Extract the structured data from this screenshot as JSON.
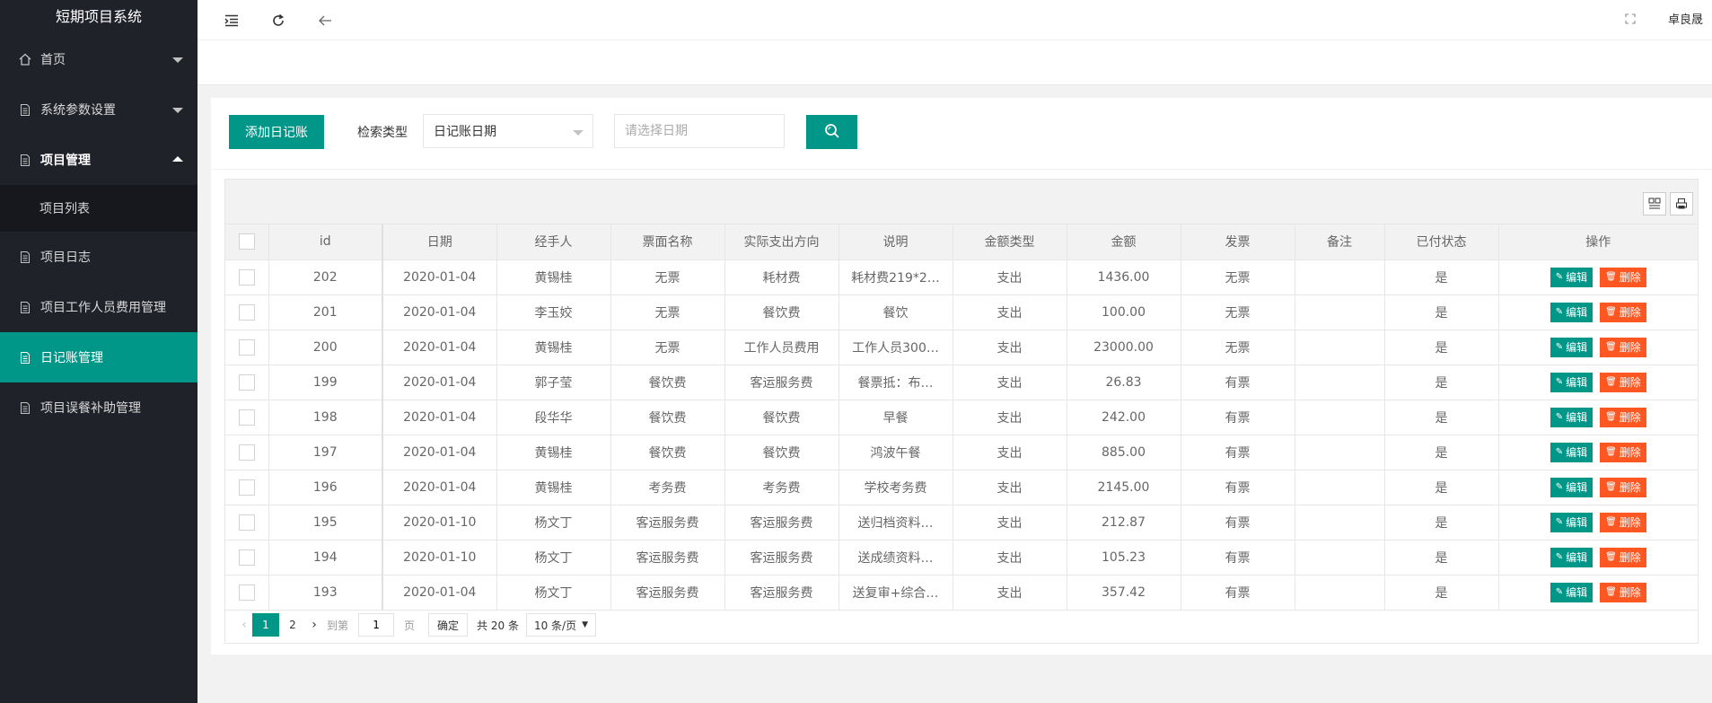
{
  "app": {
    "title": "短期项目系统",
    "user": "卓良晟"
  },
  "sidebar": {
    "items": [
      {
        "label": "首页",
        "icon": "home-icon"
      },
      {
        "label": "系统参数设置",
        "icon": "doc-icon"
      },
      {
        "label": "项目管理",
        "icon": "doc-icon",
        "sub": "项目列表"
      },
      {
        "label": "项目日志",
        "icon": "doc-icon"
      },
      {
        "label": "项目工作人员费用管理",
        "icon": "doc-icon"
      },
      {
        "label": "日记账管理",
        "icon": "doc-icon"
      },
      {
        "label": "项目误餐补助管理",
        "icon": "doc-icon"
      }
    ]
  },
  "toolbar": {
    "add_label": "添加日记账",
    "search_type_label": "检索类型",
    "search_type_value": "日记账日期",
    "date_placeholder": "请选择日期"
  },
  "table": {
    "headers": [
      "id",
      "日期",
      "经手人",
      "票面名称",
      "实际支出方向",
      "说明",
      "金额类型",
      "金额",
      "发票",
      "备注",
      "已付状态",
      "操作"
    ],
    "edit_label": "编辑",
    "delete_label": "删除",
    "rows": [
      [
        "202",
        "2020-01-04",
        "黄锡桂",
        "无票",
        "耗材费",
        "耗材费219*2…",
        "支出",
        "1436.00",
        "无票",
        "",
        "是"
      ],
      [
        "201",
        "2020-01-04",
        "李玉姣",
        "无票",
        "餐饮费",
        "餐饮",
        "支出",
        "100.00",
        "无票",
        "",
        "是"
      ],
      [
        "200",
        "2020-01-04",
        "黄锡桂",
        "无票",
        "工作人员费用",
        "工作人员300…",
        "支出",
        "23000.00",
        "无票",
        "",
        "是"
      ],
      [
        "199",
        "2020-01-04",
        "郭子莹",
        "餐饮费",
        "客运服务费",
        "餐票抵：布…",
        "支出",
        "26.83",
        "有票",
        "",
        "是"
      ],
      [
        "198",
        "2020-01-04",
        "段华华",
        "餐饮费",
        "餐饮费",
        "早餐",
        "支出",
        "242.00",
        "有票",
        "",
        "是"
      ],
      [
        "197",
        "2020-01-04",
        "黄锡桂",
        "餐饮费",
        "餐饮费",
        "鸿波午餐",
        "支出",
        "885.00",
        "有票",
        "",
        "是"
      ],
      [
        "196",
        "2020-01-04",
        "黄锡桂",
        "考务费",
        "考务费",
        "学校考务费",
        "支出",
        "2145.00",
        "有票",
        "",
        "是"
      ],
      [
        "195",
        "2020-01-10",
        "杨文丁",
        "客运服务费",
        "客运服务费",
        "送归档资料…",
        "支出",
        "212.87",
        "有票",
        "",
        "是"
      ],
      [
        "194",
        "2020-01-10",
        "杨文丁",
        "客运服务费",
        "客运服务费",
        "送成绩资料…",
        "支出",
        "105.23",
        "有票",
        "",
        "是"
      ],
      [
        "193",
        "2020-01-04",
        "杨文丁",
        "客运服务费",
        "客运服务费",
        "送复审+综合…",
        "支出",
        "357.42",
        "有票",
        "",
        "是"
      ]
    ]
  },
  "pager": {
    "pages": [
      "1",
      "2"
    ],
    "goto_label": "到第",
    "goto_value": "1",
    "page_unit": "页",
    "confirm_label": "确定",
    "total_label": "共 20 条",
    "limit_label": "10 条/页"
  }
}
